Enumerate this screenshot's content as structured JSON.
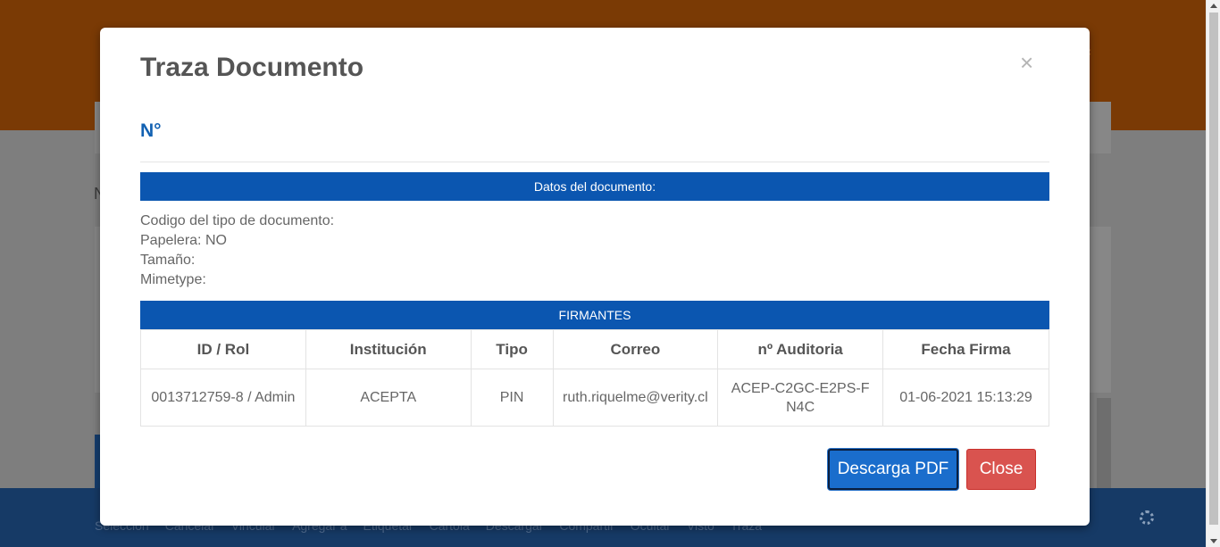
{
  "background": {
    "bottom_links": [
      "Selección",
      "Cancelar",
      "Vincular",
      "Agregar a",
      "Etiquetar",
      "Cartola",
      "Descargar",
      "Compartir",
      "Ocultar",
      "Visto",
      "Traza"
    ],
    "partial_letter": "N"
  },
  "modal": {
    "title": "Traza Documento",
    "close_symbol": "×",
    "doc_number": "N°",
    "datos_header": "Datos del documento:",
    "info": {
      "codigo": "Codigo del tipo de documento:",
      "papelera": "Papelera: NO",
      "tamano": "Tamaño:",
      "mimetype": "Mimetype:"
    },
    "firmantes_header": "FIRMANTES",
    "table": {
      "columns": [
        "ID / Rol",
        "Institución",
        "Tipo",
        "Correo",
        "nº Auditoria",
        "Fecha Firma"
      ],
      "rows": [
        {
          "id_rol": "0013712759-8 / Admin",
          "institucion": "ACEPTA",
          "tipo": "PIN",
          "correo": "ruth.riquelme@verity.cl",
          "auditoria": "ACEP-C2GC-E2PS-FN4C",
          "fecha": "01-06-2021 15:13:29"
        }
      ]
    },
    "buttons": {
      "download_pdf": "Descarga PDF",
      "close": "Close"
    }
  },
  "colors": {
    "header_orange": "#7a3a05",
    "section_blue": "#0b56b0",
    "title_blue": "#1261b2",
    "close_red": "#d9534f",
    "pdf_blue": "#1a6dcc"
  }
}
